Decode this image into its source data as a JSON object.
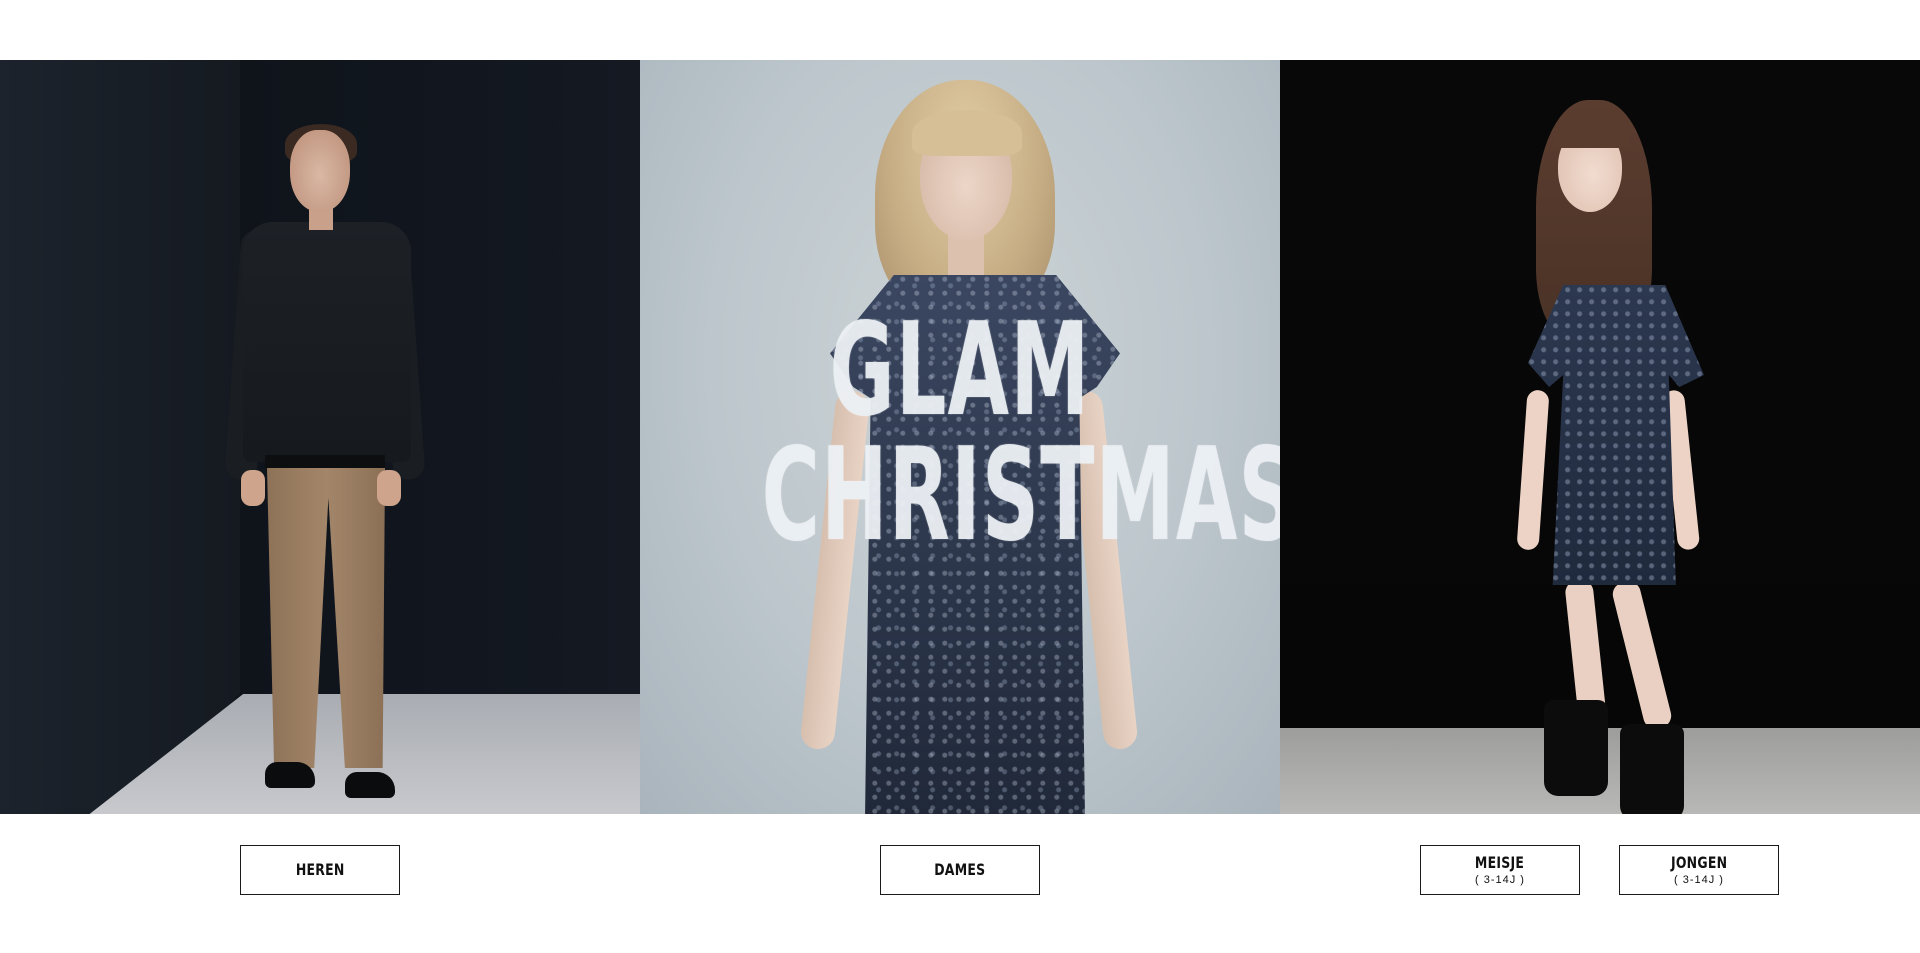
{
  "banner": {
    "headline_line1": "GLAM",
    "headline_line2": "CHRISTMAS"
  },
  "buttons": [
    {
      "label": "HEREN",
      "sub": ""
    },
    {
      "label": "DAMES",
      "sub": ""
    },
    {
      "label": "MEISJE",
      "sub": "( 3-14J )"
    },
    {
      "label": "JONGEN",
      "sub": "( 3-14J )"
    }
  ],
  "colors": {
    "page_background": "#ffffff",
    "button_border": "#1a1a1a",
    "headline": "#eceff3"
  }
}
